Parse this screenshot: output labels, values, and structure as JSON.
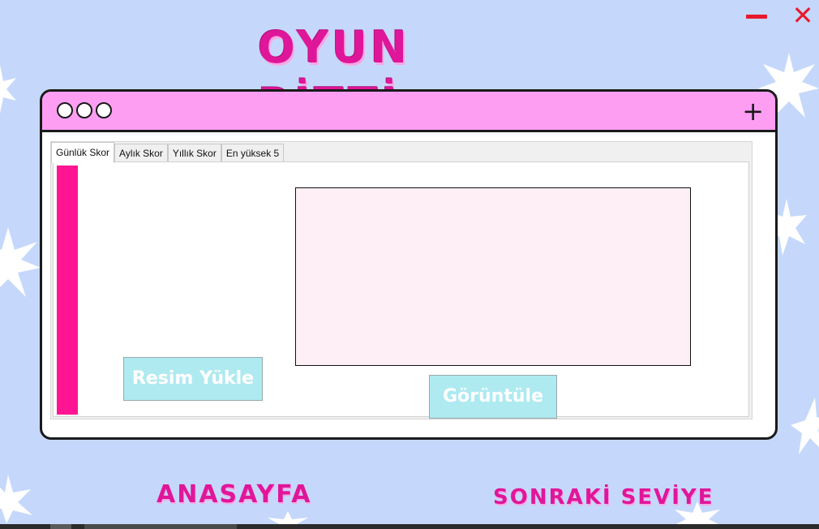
{
  "title": "OYUN BİTTİ",
  "window_controls": {
    "minimize_icon": "minimize-icon",
    "close_label": "✕"
  },
  "frame": {
    "plus_label": "+",
    "tabs": [
      {
        "label": "Günlük Skor"
      },
      {
        "label": "Aylık Skor"
      },
      {
        "label": "Yıllık Skor"
      },
      {
        "label": "En yüksek 5"
      }
    ],
    "upload_button": "Resim Yükle",
    "view_button": "Görüntüle"
  },
  "nav": {
    "home": "ANASAYFA",
    "next_level": "SONRAKİ SEVİYE"
  },
  "colors": {
    "background": "#c5d8fb",
    "accent_pink": "#e0169a",
    "header_pink": "#fd9ef3",
    "side_bar": "#ff1493",
    "button_cyan": "#aeeaf0",
    "close_red": "#e8192c"
  }
}
